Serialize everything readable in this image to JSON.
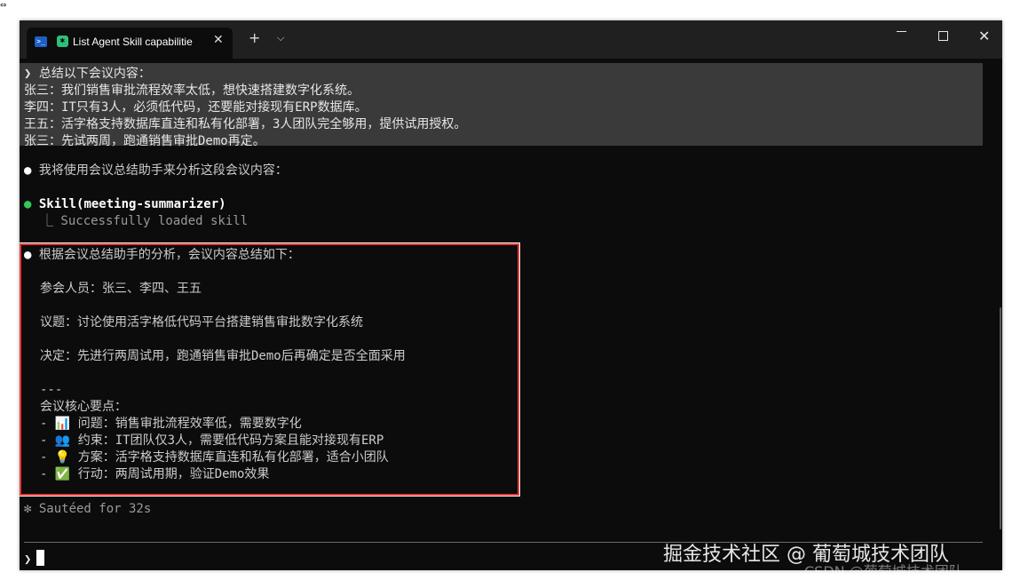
{
  "window": {
    "tab_title": "List Agent Skill capabilitie",
    "tab_close": "✕",
    "new_tab": "+",
    "tab_dropdown": "⌵",
    "minimize": "",
    "close": "✕"
  },
  "terminal": {
    "prompt_block": [
      "❯ 总结以下会议内容：",
      "张三：我们销售审批流程效率太低，想快速搭建数字化系统。",
      "李四：IT只有3人，必须低代码，还要能对接现有ERP数据库。",
      "王五：活字格支持数据库直连和私有化部署，3人团队完全够用，提供试用授权。",
      "张三：先试两周，跑通销售审批Demo再定。"
    ],
    "assistant_intro": "我将使用会议总结助手来分析这段会议内容：",
    "skill_call": "Skill(meeting-summarizer)",
    "skill_result": "⎿  Successfully loaded skill",
    "summary_intro": "根据会议总结助手的分析，会议内容总结如下：",
    "participants": "参会人员：张三、李四、王五",
    "topic": "议题：讨论使用活字格低代码平台搭建销售审批数字化系统",
    "decision": "决定：先进行两周试用，跑通销售审批Demo后再确定是否全面采用",
    "divider": "---",
    "key_points_title": "会议核心要点：",
    "key_points": [
      "- 📊 问题：销售审批流程效率低，需要数字化",
      "- 👥 约束：IT团队仅3人，需要低代码方案且能对接现有ERP",
      "- 💡 方案：活字格支持数据库直连和私有化部署，适合小团队",
      "- ✅ 行动：两周试用期，验证Demo效果"
    ],
    "status": "✻ Sautéed for 32s",
    "input_prompt": "❯"
  },
  "watermarks": {
    "juejin": "掘金技术社区 @ 葡萄城技术团队",
    "csdn": "CSDN @葡萄城技术团队"
  },
  "colors": {
    "terminal_bg": "#0c0c0c",
    "prompt_block_bg": "#3a3a3a",
    "highlight_border": "#e53935",
    "bullet_green": "#34c759"
  }
}
